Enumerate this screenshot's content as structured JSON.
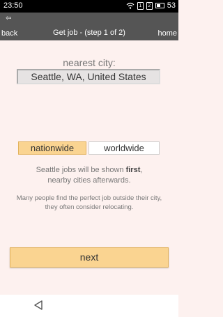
{
  "status_bar": {
    "time": "23:50",
    "sim1": "1",
    "sim2": "2",
    "battery": "53"
  },
  "header": {
    "back_label": "back",
    "title": "Get job - (step 1 of 2)",
    "home_label": "home"
  },
  "city": {
    "label": "nearest city:",
    "value": "Seattle, WA, United States"
  },
  "scope": {
    "options": [
      "nationwide",
      "worldwide"
    ],
    "selected": "nationwide"
  },
  "info": {
    "line1_pre": "Seattle jobs will be shown ",
    "line1_bold": "first",
    "line1_post": ",",
    "line2": "nearby cities afterwards.",
    "tip_line1": "Many people find the perfect job outside their city,",
    "tip_line2": "they often consider relocating."
  },
  "footer": {
    "next_label": "next"
  },
  "colors": {
    "background": "#fdf1ef",
    "topbar": "#555555",
    "accent": "#fad491",
    "accent_border": "#e2b25c"
  }
}
